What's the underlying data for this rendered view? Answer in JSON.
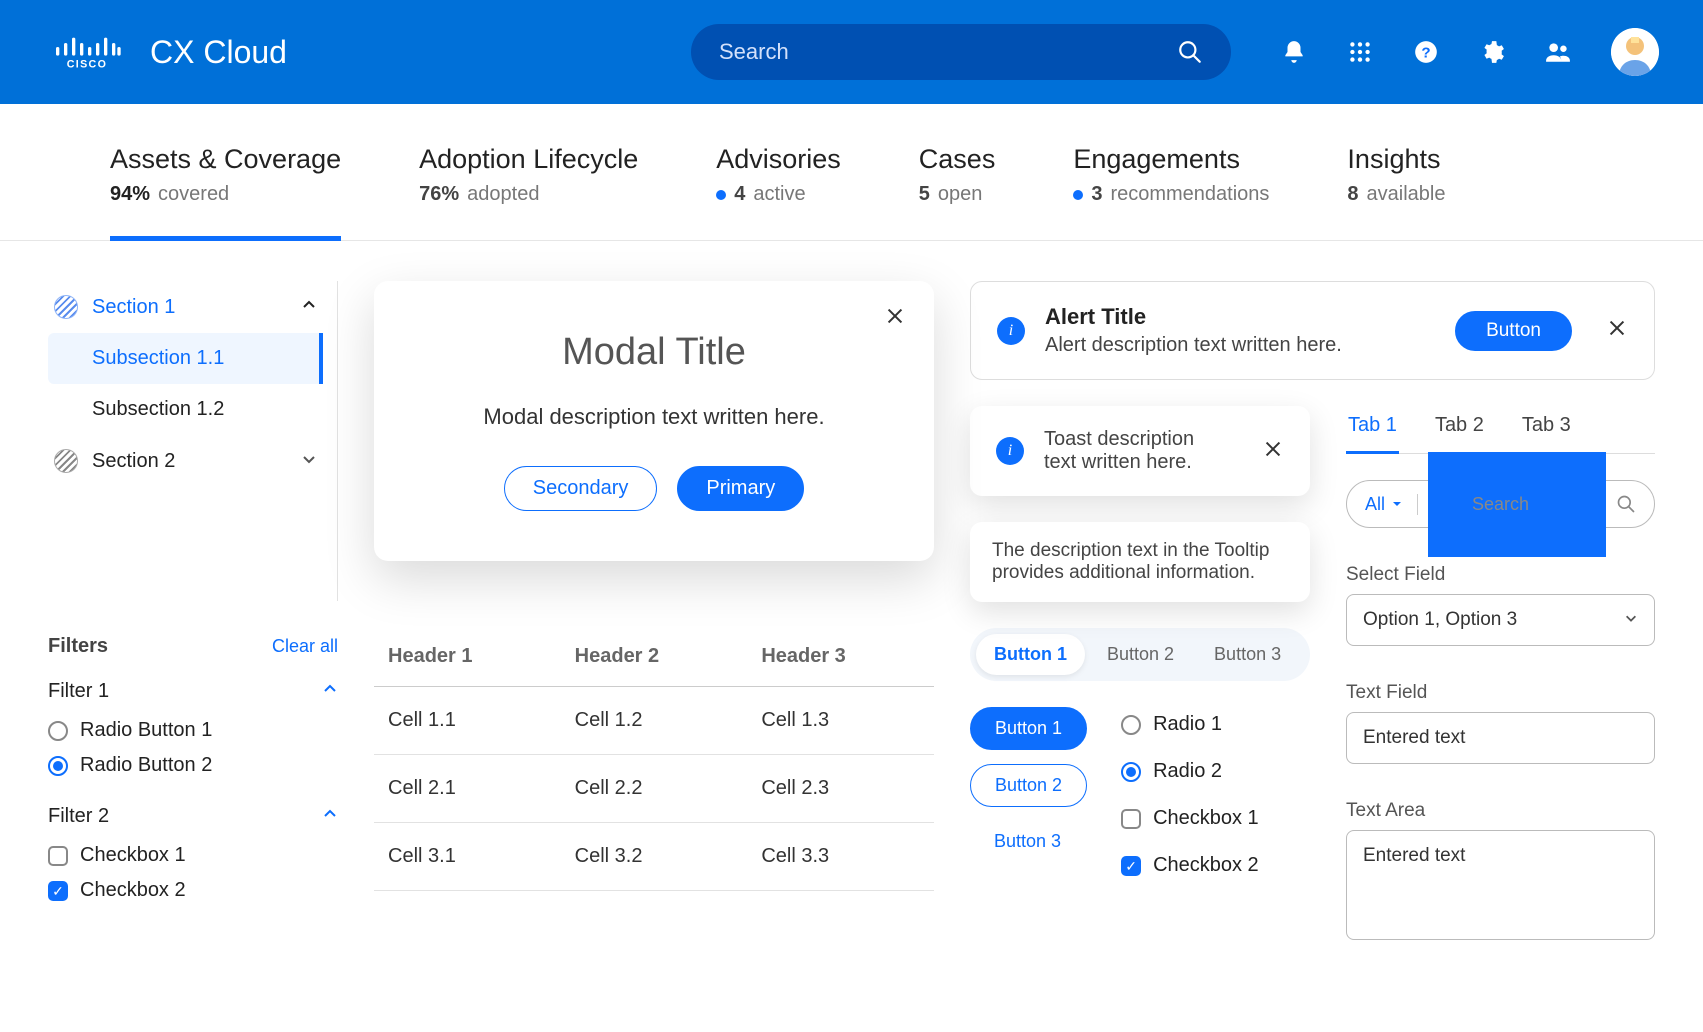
{
  "header": {
    "app_name": "CX Cloud",
    "search_placeholder": "Search"
  },
  "nav": [
    {
      "title": "Assets & Coverage",
      "stat_bold": "94%",
      "stat_rest": "covered",
      "dot": false,
      "active": true
    },
    {
      "title": "Adoption Lifecycle",
      "stat_bold": "76%",
      "stat_rest": "adopted",
      "dot": false,
      "active": false
    },
    {
      "title": "Advisories",
      "stat_bold": "4",
      "stat_rest": "active",
      "dot": true,
      "active": false
    },
    {
      "title": "Cases",
      "stat_bold": "5",
      "stat_rest": "open",
      "dot": false,
      "active": false
    },
    {
      "title": "Engagements",
      "stat_bold": "3",
      "stat_rest": "recommendations",
      "dot": true,
      "active": false
    },
    {
      "title": "Insights",
      "stat_bold": "8",
      "stat_rest": "available",
      "dot": false,
      "active": false
    }
  ],
  "sidebar": {
    "sections": [
      {
        "label": "Section 1",
        "expanded": true,
        "active": true,
        "subs": [
          {
            "label": "Subsection 1.1",
            "active": true
          },
          {
            "label": "Subsection 1.2",
            "active": false
          }
        ]
      },
      {
        "label": "Section 2",
        "expanded": false,
        "active": false,
        "subs": []
      }
    ],
    "filters_title": "Filters",
    "clear_all": "Clear all",
    "filters": [
      {
        "title": "Filter 1",
        "type": "radio",
        "options": [
          {
            "label": "Radio Button 1",
            "on": false
          },
          {
            "label": "Radio Button 2",
            "on": true
          }
        ]
      },
      {
        "title": "Filter 2",
        "type": "check",
        "options": [
          {
            "label": "Checkbox 1",
            "on": false
          },
          {
            "label": "Checkbox 2",
            "on": true
          }
        ]
      }
    ]
  },
  "modal": {
    "title": "Modal Title",
    "desc": "Modal description text written here.",
    "secondary": "Secondary",
    "primary": "Primary"
  },
  "table": {
    "headers": [
      "Header 1",
      "Header 2",
      "Header 3"
    ],
    "rows": [
      [
        "Cell 1.1",
        "Cell 1.2",
        "Cell 1.3"
      ],
      [
        "Cell 2.1",
        "Cell 2.2",
        "Cell 2.3"
      ],
      [
        "Cell 3.1",
        "Cell 3.2",
        "Cell 3.3"
      ]
    ]
  },
  "alert": {
    "title": "Alert Title",
    "desc": "Alert description text written here.",
    "button": "Button"
  },
  "toast": {
    "desc": "Toast description text written here."
  },
  "tooltip": {
    "text": "The description text in the Tooltip provides additional information."
  },
  "segmented": [
    "Button 1",
    "Button 2",
    "Button 3"
  ],
  "btnstack": [
    "Button 1",
    "Button 2",
    "Button 3"
  ],
  "radiostack": [
    {
      "label": "Radio 1",
      "on": false
    },
    {
      "label": "Radio 2",
      "on": true
    },
    {
      "label": "Checkbox 1",
      "on": false,
      "check": true
    },
    {
      "label": "Checkbox 2",
      "on": true,
      "check": true
    }
  ],
  "tabs2": [
    "Tab 1",
    "Tab 2",
    "Tab 3"
  ],
  "searchcombo": {
    "selector": "All",
    "placeholder": "Search"
  },
  "select_field": {
    "label": "Select Field",
    "value": "Option 1, Option 3"
  },
  "text_field": {
    "label": "Text Field",
    "value": "Entered text"
  },
  "text_area": {
    "label": "Text Area",
    "value": "Entered text"
  }
}
